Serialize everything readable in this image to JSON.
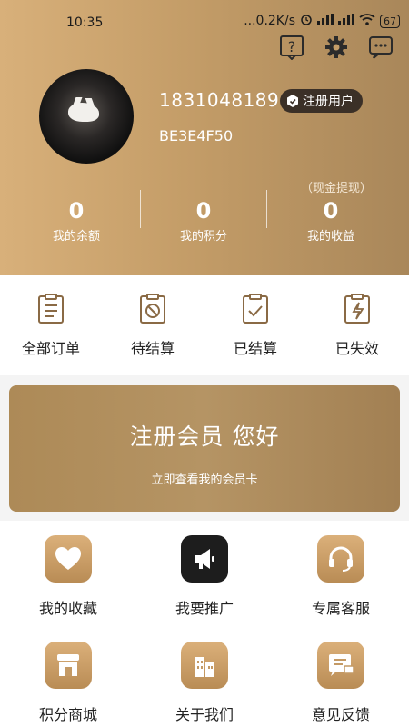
{
  "status_bar": {
    "time": "10:35",
    "net_speed": "...0.2K/s",
    "battery": "67"
  },
  "top_icons": [
    "help-icon",
    "settings-icon",
    "message-icon"
  ],
  "profile": {
    "phone": "18310481896",
    "badge": "注册用户",
    "user_code": "BE3E4F50"
  },
  "stats": {
    "cash_withdraw": "（现金提现）",
    "items": [
      {
        "value": "0",
        "label": "我的余额"
      },
      {
        "value": "0",
        "label": "我的积分"
      },
      {
        "value": "0",
        "label": "我的收益"
      }
    ]
  },
  "orders": [
    {
      "label": "全部订单",
      "icon": "order-list-icon"
    },
    {
      "label": "待结算",
      "icon": "pending-icon"
    },
    {
      "label": "已结算",
      "icon": "settled-icon"
    },
    {
      "label": "已失效",
      "icon": "expired-icon"
    }
  ],
  "banner": {
    "title": "注册会员 您好",
    "subtitle": "立即查看我的会员卡"
  },
  "menu": [
    {
      "label": "我的收藏",
      "icon": "heart-icon"
    },
    {
      "label": "我要推广",
      "icon": "megaphone-icon"
    },
    {
      "label": "专属客服",
      "icon": "headset-icon"
    },
    {
      "label": "积分商城",
      "icon": "store-icon"
    },
    {
      "label": "关于我们",
      "icon": "buildings-icon"
    },
    {
      "label": "意见反馈",
      "icon": "feedback-icon"
    }
  ],
  "colors": {
    "gold": "#c49d68",
    "dark_gold": "#b07f45",
    "banner": "#b08d5d"
  }
}
